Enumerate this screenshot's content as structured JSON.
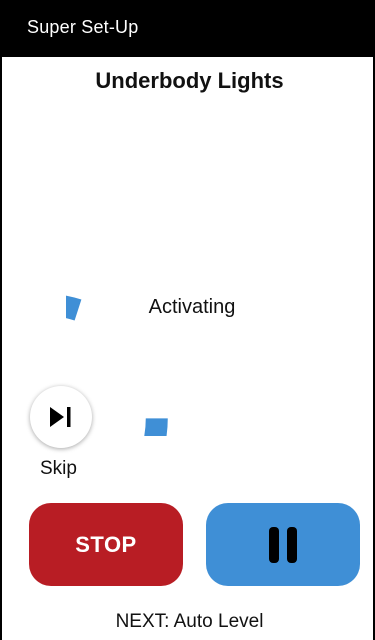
{
  "app_bar": {
    "title": "Super Set-Up"
  },
  "page": {
    "title": "Underbody Lights"
  },
  "progress": {
    "status_label": "Activating",
    "fraction": 0.8,
    "color": "#3f8fd6"
  },
  "skip": {
    "label": "Skip",
    "icon": "skip-next-icon"
  },
  "controls": {
    "stop_label": "STOP",
    "stop_color": "#b81d24",
    "pause_icon": "pause-icon",
    "pause_color": "#3f8fd6"
  },
  "footer": {
    "next_text": "NEXT: Auto Level"
  }
}
